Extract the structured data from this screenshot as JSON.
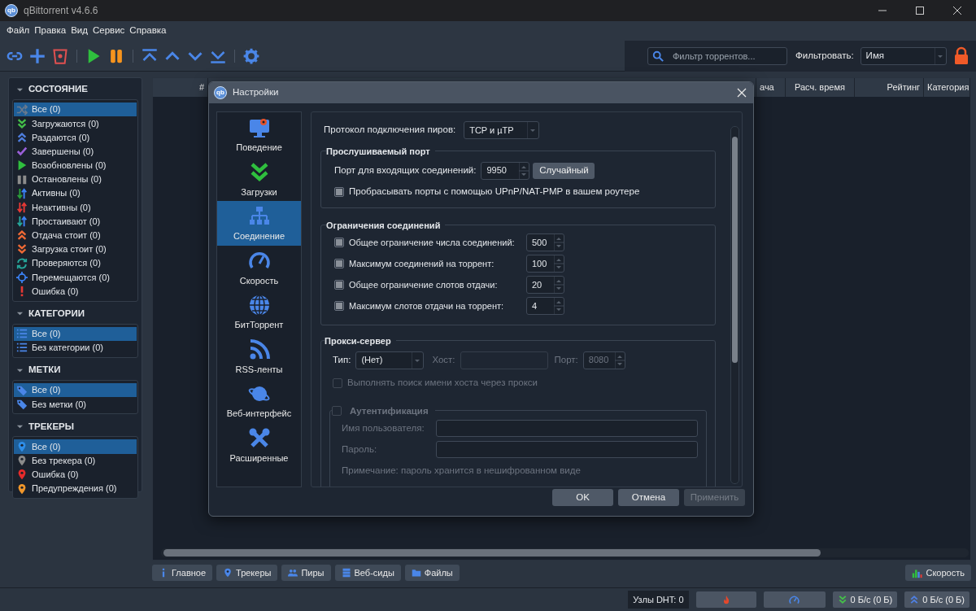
{
  "window": {
    "logo": "qb",
    "title": "qBittorrent v4.6.6"
  },
  "menu": [
    {
      "label": "Файл"
    },
    {
      "label": "Правка"
    },
    {
      "label": "Вид"
    },
    {
      "label": "Сервис"
    },
    {
      "label": "Справка"
    }
  ],
  "toolbar": {
    "search": {
      "placeholder": "Фильтр торрентов..."
    },
    "filter_label": "Фильтровать:",
    "filter_value": "Имя"
  },
  "sidebar": [
    {
      "title": "СОСТОЯНИЕ",
      "expanded": true,
      "items": [
        {
          "label": "Все (0)",
          "selected": true
        },
        {
          "label": "Загружаются (0)",
          "selected": false
        },
        {
          "label": "Раздаются (0)",
          "selected": false
        },
        {
          "label": "Завершены (0)",
          "selected": false
        },
        {
          "label": "Возобновлены (0)",
          "selected": false
        },
        {
          "label": "Остановлены (0)",
          "selected": false
        },
        {
          "label": "Активны (0)",
          "selected": false
        },
        {
          "label": "Неактивны (0)",
          "selected": false
        },
        {
          "label": "Простаивают (0)",
          "selected": false
        },
        {
          "label": "Отдача стоит (0)",
          "selected": false
        },
        {
          "label": "Загрузка стоит (0)",
          "selected": false
        },
        {
          "label": "Проверяются (0)",
          "selected": false
        },
        {
          "label": "Перемещаются (0)",
          "selected": false
        },
        {
          "label": "Ошибка (0)",
          "selected": false
        }
      ]
    },
    {
      "title": "КАТЕГОРИИ",
      "expanded": true,
      "items": [
        {
          "label": "Все (0)",
          "selected": true
        },
        {
          "label": "Без категории (0)",
          "selected": false
        }
      ]
    },
    {
      "title": "МЕТКИ",
      "expanded": true,
      "items": [
        {
          "label": "Все (0)",
          "selected": true
        },
        {
          "label": "Без метки (0)",
          "selected": false
        }
      ]
    },
    {
      "title": "ТРЕКЕРЫ",
      "expanded": true,
      "items": [
        {
          "label": "Все (0)",
          "selected": true
        },
        {
          "label": "Без трекера (0)",
          "selected": false
        },
        {
          "label": "Ошибка (0)",
          "selected": false
        },
        {
          "label": "Предупреждения (0)",
          "selected": false
        }
      ]
    }
  ],
  "table": {
    "columns": [
      "#",
      "ача",
      "Расч. время",
      "Рейтинг",
      "Категория"
    ]
  },
  "detail_tabs": [
    {
      "label": "Главное"
    },
    {
      "label": "Трекеры"
    },
    {
      "label": "Пиры"
    },
    {
      "label": "Веб-сиды"
    },
    {
      "label": "Файлы"
    }
  ],
  "speed_button": "Скорость",
  "status_bar": {
    "dht": "Узлы DHT: 0",
    "download": "0 Б/с (0 Б)",
    "upload": "0 Б/с (0 Б)"
  },
  "dialog": {
    "logo": "qb",
    "title": "Настройки",
    "nav": [
      {
        "label": "Поведение",
        "selected": false
      },
      {
        "label": "Загрузки",
        "selected": false
      },
      {
        "label": "Соединение",
        "selected": true
      },
      {
        "label": "Скорость",
        "selected": false
      },
      {
        "label": "БитТоррент",
        "selected": false
      },
      {
        "label": "RSS-ленты",
        "selected": false
      },
      {
        "label": "Веб-интерфейс",
        "selected": false
      },
      {
        "label": "Расширенные",
        "selected": false
      }
    ],
    "protocol": {
      "label": "Протокол подключения пиров:",
      "value": "TCP и µTP"
    },
    "listen_port": {
      "title": "Прослушиваемый порт",
      "port_label": "Порт для входящих соединений:",
      "port": "9950",
      "random_button": "Случайный",
      "upnp": {
        "label": "Пробрасывать порты с помощью UPnP/NAT-PMP в вашем роутере",
        "checked": false
      }
    },
    "limits": {
      "title": "Ограничения соединений",
      "rows": [
        {
          "label": "Общее ограничение числа соединений:",
          "value": "500",
          "checked": false
        },
        {
          "label": "Максимум соединений на торрент:",
          "value": "100",
          "checked": false
        },
        {
          "label": "Общее ограничение слотов отдачи:",
          "value": "20",
          "checked": false
        },
        {
          "label": "Максимум слотов отдачи на торрент:",
          "value": "4",
          "checked": false
        }
      ]
    },
    "proxy": {
      "title": "Прокси-сервер",
      "type_label": "Тип:",
      "type_value": "(Нет)",
      "host_label": "Хост:",
      "port_label": "Порт:",
      "port": "8080",
      "fields_enabled": false,
      "hostname_lookup": {
        "label": "Выполнять поиск имени хоста через прокси",
        "checked": false,
        "disabled": true
      },
      "auth": {
        "title": "Аутентификация",
        "checked": false,
        "disabled": true,
        "username_label": "Имя пользователя:",
        "password_label": "Пароль:",
        "note": "Примечание: пароль хранится в нешифрованном виде"
      }
    },
    "buttons": [
      {
        "label": "OK",
        "disabled": false
      },
      {
        "label": "Отмена",
        "disabled": false
      },
      {
        "label": "Применить",
        "disabled": true
      }
    ]
  }
}
